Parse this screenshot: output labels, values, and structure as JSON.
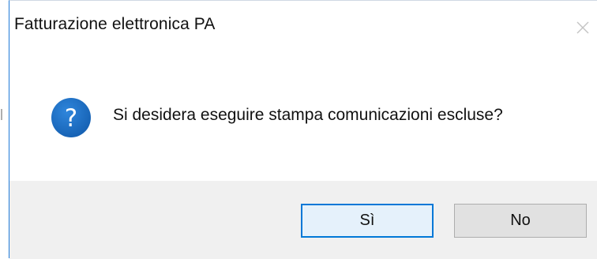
{
  "window": {
    "title": "Fatturazione elettronica PA",
    "close_icon": "close-icon"
  },
  "content": {
    "icon": "question-icon",
    "message": "Si desidera eseguire stampa comunicazioni escluse?"
  },
  "buttons": {
    "yes_label": "Sì",
    "no_label": "No"
  },
  "colors": {
    "accent": "#0078d7",
    "icon_blue": "#1f6fc5",
    "footer_bg": "#f0f0f0"
  }
}
